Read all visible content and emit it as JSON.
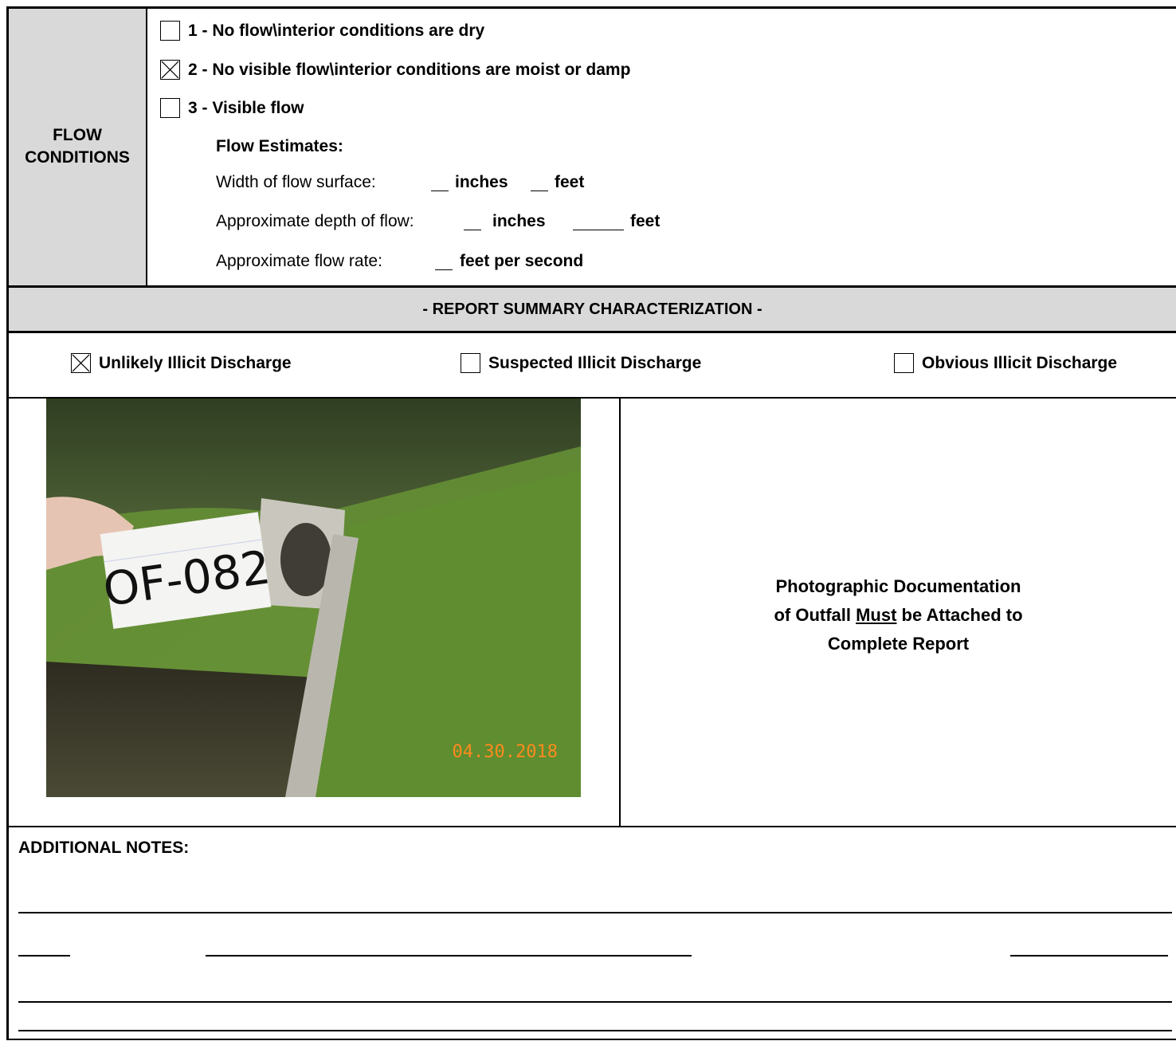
{
  "flow_conditions": {
    "label_line1": "FLOW",
    "label_line2": "CONDITIONS",
    "options": [
      {
        "text": "1 - No flow\\interior conditions are dry",
        "checked": false
      },
      {
        "text": "2 - No visible flow\\interior conditions are moist or damp",
        "checked": true
      },
      {
        "text": "3 - Visible flow",
        "checked": false
      }
    ],
    "estimates_title": "Flow Estimates:",
    "width_label": "Width of flow surface:",
    "depth_label": "Approximate depth of flow:",
    "rate_label": "Approximate flow rate:",
    "unit_inches": "inches",
    "unit_feet": "feet",
    "unit_fps": "feet per second"
  },
  "summary": {
    "header": "- REPORT SUMMARY CHARACTERIZATION -",
    "options": [
      {
        "text": "Unlikely Illicit Discharge",
        "checked": true
      },
      {
        "text": "Suspected Illicit Discharge",
        "checked": false
      },
      {
        "text": "Obvious Illicit Discharge",
        "checked": false
      }
    ]
  },
  "photo": {
    "sign_text": "OF-082",
    "date_stamp": "04.30.2018",
    "doc_line1": "Photographic Documentation",
    "doc_line2_pre": "of Outfall ",
    "doc_line2_em": "Must",
    "doc_line2_post": " be Attached to",
    "doc_line3": "Complete Report"
  },
  "notes": {
    "label": "ADDITIONAL NOTES:"
  },
  "colors": {
    "header_gray": "#d9d9d9",
    "date_orange": "#ff8a1e"
  }
}
